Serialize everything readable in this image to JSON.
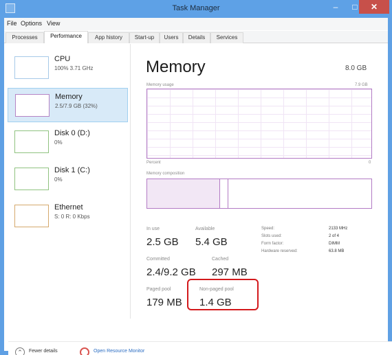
{
  "window": {
    "title": "Task Manager",
    "min": "–",
    "max": "□",
    "close": "✕"
  },
  "menu": [
    "File",
    "Options",
    "View"
  ],
  "tabs": [
    "Processes",
    "Performance",
    "App history",
    "Start-up",
    "Users",
    "Details",
    "Services"
  ],
  "left": {
    "items": [
      {
        "name": "CPU",
        "sub": "100% 3.71 GHz"
      },
      {
        "name": "Memory",
        "sub": "2.5/7.9 GB (32%)"
      },
      {
        "name": "Disk 0 (D:)",
        "sub": "0%"
      },
      {
        "name": "Disk 1 (C:)",
        "sub": "0%"
      },
      {
        "name": "Ethernet",
        "sub": "S: 0 R: 0 Kbps"
      }
    ]
  },
  "main": {
    "title": "Memory",
    "total": "8.0 GB",
    "usage_label": "Memory usage",
    "usage_max": "7.9 GB",
    "seconds": "Percent",
    "zero": "0",
    "composition_label": "Memory composition",
    "stats": {
      "in_use_label": "In use",
      "in_use_val": "2.5 GB",
      "available_label": "Available",
      "available_val": "5.4 GB",
      "committed_label": "Committed",
      "committed_val": "2.4/9.2 GB",
      "cached_label": "Cached",
      "cached_val": "297 MB",
      "paged_label": "Paged pool",
      "paged_val": "179 MB",
      "nonpaged_label": "Non-paged pool",
      "nonpaged_val": "1.4 GB"
    },
    "kv": [
      {
        "label": "Speed:",
        "value": "2133 MHz"
      },
      {
        "label": "Slots used:",
        "value": "2 of 4"
      },
      {
        "label": "Form factor:",
        "value": "DIMM"
      },
      {
        "label": "Hardware reserved:",
        "value": "63.8 MB"
      }
    ]
  },
  "footer": {
    "fewer": "Fewer details",
    "resmon": "Open Resource Monitor"
  }
}
